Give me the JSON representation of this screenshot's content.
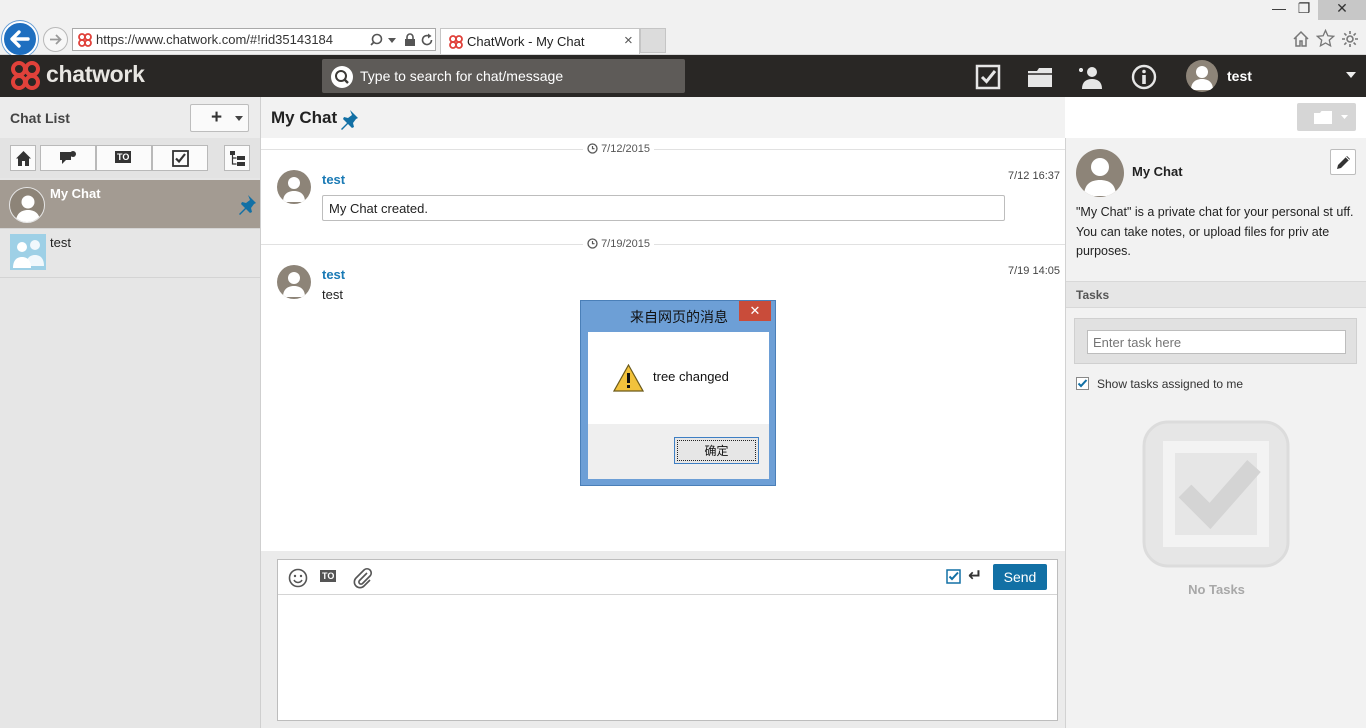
{
  "browser": {
    "url": "https://www.chatwork.com/#!rid35143184",
    "tab_title": "ChatWork - My Chat",
    "tab_close": "×"
  },
  "window_controls": {
    "minimize": "—",
    "maximize": "❐",
    "close": "✕"
  },
  "header": {
    "logo": "chatwork",
    "search_placeholder": "Type to search for chat/message",
    "user_name": "test"
  },
  "sidebar": {
    "title": "Chat List",
    "add_label": "+",
    "filters": [
      "home",
      "unread",
      "TO",
      "tasks"
    ],
    "rooms": [
      {
        "name": "My Chat",
        "pinned": true,
        "selected": true
      },
      {
        "name": "test",
        "pinned": false,
        "selected": false
      }
    ]
  },
  "main": {
    "room_title": "My Chat",
    "messages": [
      {
        "date": "7/12/2015",
        "sender": "test",
        "time": "7/12 16:37",
        "text": "My Chat created."
      },
      {
        "date": "7/19/2015",
        "sender": "test",
        "time": "7/19 14:05",
        "text": "test"
      }
    ],
    "compose": {
      "to_label": "TO",
      "send_label": "Send",
      "enter_icon": "↵"
    }
  },
  "right_panel": {
    "room_name": "My Chat",
    "description": "\"My Chat\" is a private chat for your personal st uff. You can take notes, or upload files for priv ate purposes.",
    "tasks_header": "Tasks",
    "task_placeholder": "Enter task here",
    "show_assigned_label": "Show tasks assigned to me",
    "show_assigned_checked": true,
    "no_tasks": "No Tasks"
  },
  "dialog": {
    "title": "来自网页的消息",
    "close": "✕",
    "message": "tree changed",
    "ok_label": "确定"
  },
  "colors": {
    "header_bg": "#292725",
    "accent_blue": "#1270a5",
    "sender_blue": "#1a7ab5",
    "logo_red": "#e0413a"
  }
}
